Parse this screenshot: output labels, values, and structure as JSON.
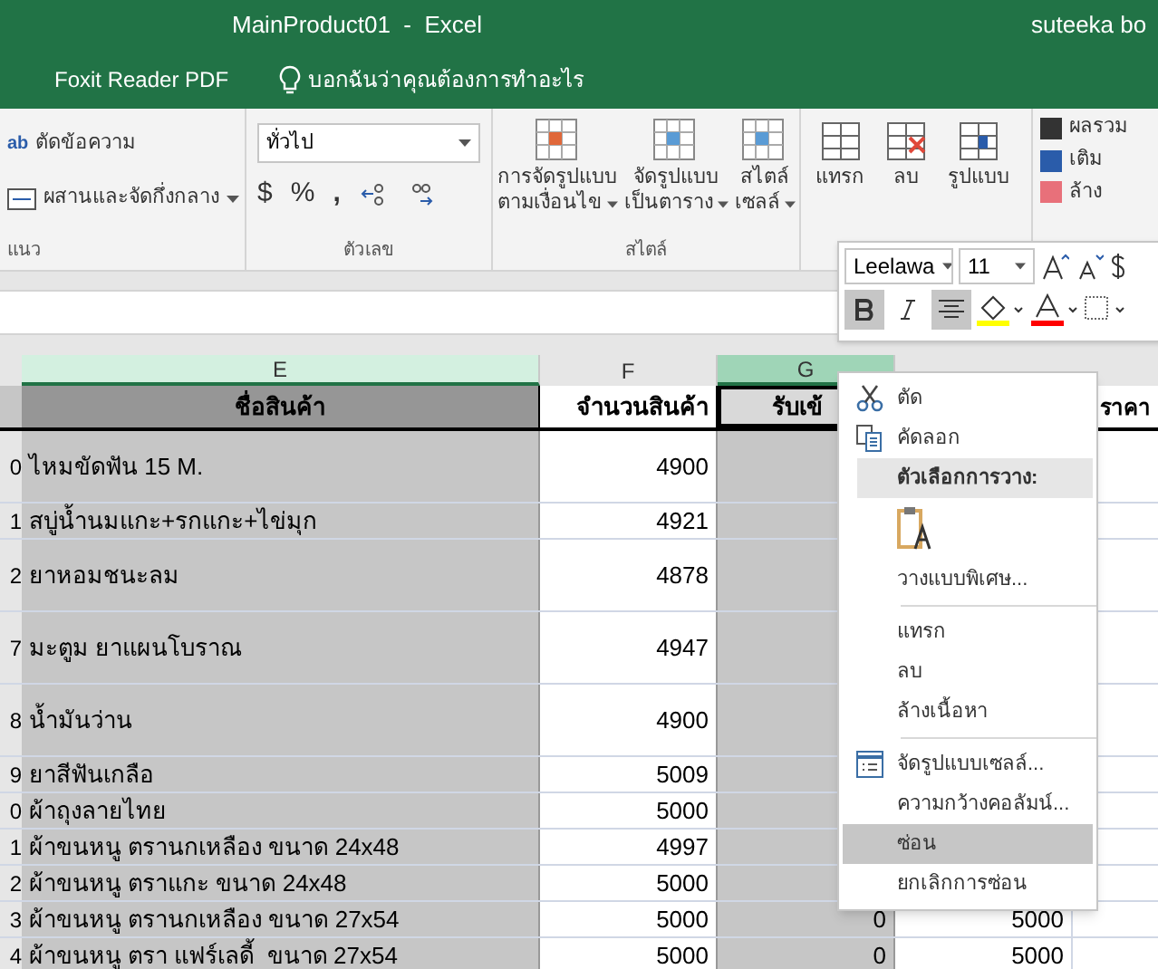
{
  "window": {
    "title": "MainProduct01  -  Excel",
    "user": "suteeka bo"
  },
  "ribbon_bar": {
    "tab": "Foxit Reader PDF",
    "tell_me": "บอกฉันว่าคุณต้องการทำอะไร"
  },
  "ribbon": {
    "alignment": {
      "wrap_icon": "ab",
      "wrap": "ตัดข้อความ",
      "merge": "ผสานและจัดกึ่งกลาง",
      "label": "แนว"
    },
    "number": {
      "format": "ทั่วไป",
      "currency": "$",
      "percent": "%",
      "comma": ",",
      "label": "ตัวเลข"
    },
    "styles": {
      "conditional": [
        "การจัดรูปแบบ",
        "ตามเงื่อนไข"
      ],
      "table": [
        "จัดรูปแบบ",
        "เป็นตาราง"
      ],
      "cell": [
        "สไตล์",
        "เซลล์"
      ],
      "label": "สไตล์"
    },
    "cells": [
      "แทรก",
      "ลบ",
      "รูปแบบ"
    ],
    "editing": [
      "ผลรวม",
      "เติม",
      "ล้าง"
    ]
  },
  "columns": [
    {
      "label": "E",
      "selected": true
    },
    {
      "label": "F",
      "selected": false
    },
    {
      "label": "G",
      "selected": true
    }
  ],
  "header_row": [
    {
      "text": "ชื่อสินค้า",
      "selected": true
    },
    {
      "text": "จำนวนสินค้า",
      "selected": false
    },
    {
      "text": "รับเข้",
      "selected": true
    },
    {
      "text": "ราคา",
      "selected": false
    }
  ],
  "rows": [
    {
      "row": "0",
      "name": "ไหมขัดฟัน 15 M.",
      "qty": "4900",
      "tall": true
    },
    {
      "row": "1",
      "name": "สบู่น้ำนมแกะ+รกแกะ+ไข่มุก",
      "qty": "4921",
      "tall": false
    },
    {
      "row": "2",
      "name": "ยาหอมชนะลม",
      "qty": "4878",
      "tall": true
    },
    {
      "row": "7",
      "name": "มะตูม ยาแผนโบราณ",
      "qty": "4947",
      "tall": true
    },
    {
      "row": "8",
      "name": "น้ำมันว่าน",
      "qty": "4900",
      "tall": true
    },
    {
      "row": "9",
      "name": "ยาสีฟันเกลือ",
      "qty": "5009",
      "tall": false
    },
    {
      "row": "0",
      "name": "ผ้าถุงลายไทย",
      "qty": "5000",
      "tall": false
    },
    {
      "row": "1",
      "name": "ผ้าขนหนู ตรานกเหลือง ขนาด 24x48",
      "qty": "4997",
      "tall": false
    },
    {
      "row": "2",
      "name": "ผ้าขนหนู ตราแกะ ขนาด 24x48",
      "qty": "5000",
      "tall": false
    },
    {
      "row": "3",
      "name": "ผ้าขนหนู ตรานกเหลือง ขนาด 27x54",
      "qty": "5000",
      "tall": false,
      "received": "0",
      "price": "5000"
    },
    {
      "row": "4",
      "name": "ผ้าขนหนู ตรา แฟร์เลดี้  ขนาด 27x54",
      "qty": "5000",
      "tall": false,
      "received": "0",
      "price": "5000"
    }
  ],
  "mini_toolbar": {
    "font": "Leelawa",
    "size": "11",
    "bold": true,
    "italic": false,
    "center": true
  },
  "context_menu": [
    {
      "kind": "cut",
      "label": "ตัด",
      "selected": false
    },
    {
      "kind": "copy",
      "label": "คัดลอก",
      "selected": false
    },
    {
      "kind": "header",
      "label": "ตัวเลือกการวาง:"
    },
    {
      "kind": "paste"
    },
    {
      "kind": "item",
      "label": "วางแบบพิเศษ...",
      "selected": false
    },
    {
      "kind": "separator"
    },
    {
      "kind": "item",
      "label": "แทรก",
      "selected": false
    },
    {
      "kind": "item",
      "label": "ลบ",
      "selected": false
    },
    {
      "kind": "item",
      "label": "ล้างเนื้อหา",
      "selected": false
    },
    {
      "kind": "separator"
    },
    {
      "kind": "format",
      "label": "จัดรูปแบบเซลล์...",
      "selected": false
    },
    {
      "kind": "item",
      "label": "ความกว้างคอลัมน์...",
      "selected": false
    },
    {
      "kind": "item",
      "label": "ซ่อน",
      "selected": true
    },
    {
      "kind": "item",
      "label": "ยกเลิกการซ่อน",
      "selected": false
    }
  ]
}
